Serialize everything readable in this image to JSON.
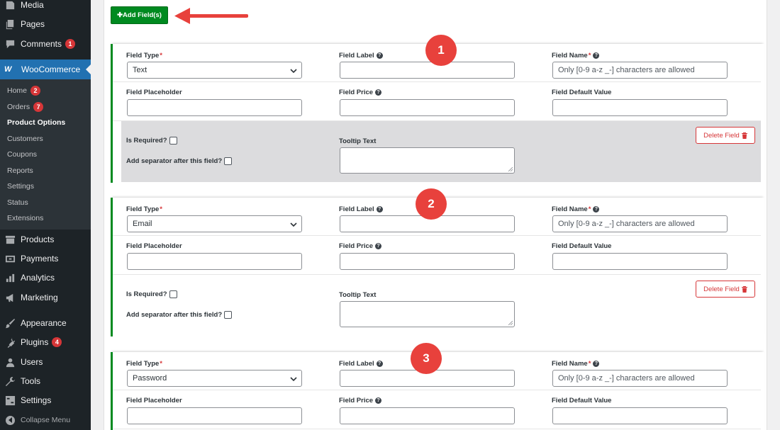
{
  "sidebar": {
    "items_top": [
      {
        "label": "Media",
        "icon": "media-icon"
      },
      {
        "label": "Pages",
        "icon": "pages-icon"
      },
      {
        "label": "Comments",
        "icon": "comments-icon",
        "badge": "1"
      }
    ],
    "active": {
      "label": "WooCommerce",
      "logo": "W"
    },
    "submenu": [
      {
        "label": "Home",
        "badge": "2"
      },
      {
        "label": "Orders",
        "badge": "7"
      },
      {
        "label": "Product Options",
        "current": true
      },
      {
        "label": "Customers"
      },
      {
        "label": "Coupons"
      },
      {
        "label": "Reports"
      },
      {
        "label": "Settings"
      },
      {
        "label": "Status"
      },
      {
        "label": "Extensions"
      }
    ],
    "items_bottom": [
      {
        "label": "Products",
        "icon": "archive-icon"
      },
      {
        "label": "Payments",
        "icon": "payments-icon"
      },
      {
        "label": "Analytics",
        "icon": "analytics-icon"
      },
      {
        "label": "Marketing",
        "icon": "megaphone-icon"
      },
      {
        "label": "Appearance",
        "icon": "paintbrush-icon"
      },
      {
        "label": "Plugins",
        "icon": "plugin-icon",
        "badge": "4"
      },
      {
        "label": "Users",
        "icon": "users-icon"
      },
      {
        "label": "Tools",
        "icon": "wrench-icon"
      },
      {
        "label": "Settings",
        "icon": "settings-icon"
      }
    ],
    "collapse_label": "Collapse Menu"
  },
  "toolbar": {
    "add_label": "Add Field(s)",
    "add_icon_glyph": "✚"
  },
  "field_labels": {
    "type": "Field Type",
    "label": "Field Label",
    "name": "Field Name",
    "placeholder": "Field Placeholder",
    "price": "Field Price",
    "default": "Field Default Value",
    "required": "Is Required?",
    "separator": "Add separator after this field?",
    "tooltip": "Tooltip Text",
    "delete": "Delete Field",
    "required_mark": "*",
    "help_glyph": "?"
  },
  "name_placeholder": "Only [0-9 a-z _-] characters are allowed",
  "fields": [
    {
      "number": "1",
      "type_value": "Text"
    },
    {
      "number": "2",
      "type_value": "Email"
    },
    {
      "number": "3",
      "type_value": "Password"
    }
  ],
  "colors": {
    "accent_green": "#008a20",
    "danger_red": "#d63638",
    "callout_red": "#e8413c",
    "wp_blue": "#2271b1"
  }
}
